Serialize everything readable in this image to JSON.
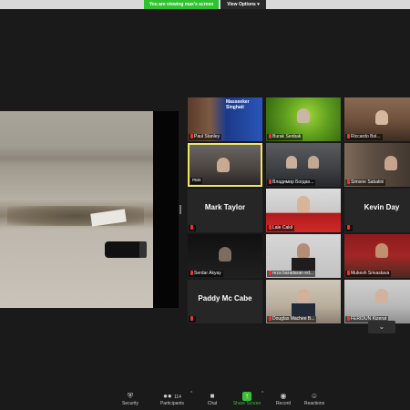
{
  "topbar": {
    "viewing_text": "You are viewing max's screen",
    "view_options": "View Options ▾"
  },
  "participants": [
    {
      "name": "Paul Stanley",
      "tile_text": "",
      "mic_muted": true,
      "active": false,
      "banner": "Masseeker Singhati"
    },
    {
      "name": "Burak Senbak",
      "tile_text": "",
      "mic_muted": true,
      "active": false
    },
    {
      "name": "Riccardo Bol...",
      "tile_text": "",
      "mic_muted": true,
      "active": false
    },
    {
      "name": "max",
      "tile_text": "",
      "mic_muted": false,
      "active": true
    },
    {
      "name": "Владимир Богдан...",
      "tile_text": "",
      "mic_muted": true,
      "active": false
    },
    {
      "name": "Simone Sabatini",
      "tile_text": "",
      "mic_muted": true,
      "active": false
    },
    {
      "name": "",
      "tile_text": "Mark Taylor",
      "mic_muted": true,
      "active": false
    },
    {
      "name": "Lale Cakil",
      "tile_text": "",
      "mic_muted": true,
      "active": false
    },
    {
      "name": "",
      "tile_text": "Kevin Day",
      "mic_muted": true,
      "active": false
    },
    {
      "name": "Serdar Akyay",
      "tile_text": "",
      "mic_muted": true,
      "active": false
    },
    {
      "name": "reza baradaran ed...",
      "tile_text": "",
      "mic_muted": true,
      "active": false
    },
    {
      "name": "Mukesh Srivastava",
      "tile_text": "",
      "mic_muted": true,
      "active": false
    },
    {
      "name": "",
      "tile_text": "Paddy Mc Cabe",
      "mic_muted": true,
      "active": false
    },
    {
      "name": "Douglas Machee B...",
      "tile_text": "",
      "mic_muted": true,
      "active": false
    },
    {
      "name": "FERIDUN Kizerat",
      "tile_text": "",
      "mic_muted": true,
      "active": false
    }
  ],
  "toolbar": {
    "security": "Security",
    "participants": "Participants",
    "participants_count": "114",
    "chat": "Chat",
    "share_screen": "Share Screen",
    "record": "Record",
    "reactions": "Reactions"
  },
  "scroll_down": "⌄",
  "colors": {
    "background": "#1a1a1a",
    "viewing_green": "#2fc42f",
    "active_speaker": "#f1e46a",
    "muted_red": "#e33333"
  }
}
